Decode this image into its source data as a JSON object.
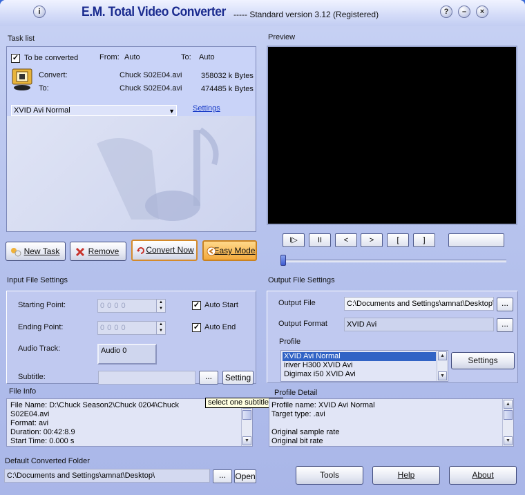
{
  "window": {
    "title": "E.M. Total Video Converter",
    "subtitle": "-----  Standard version 3.12 (Registered)",
    "info_glyph": "i",
    "help_glyph": "?",
    "min_glyph": "–",
    "close_glyph": "×"
  },
  "task_list": {
    "label": "Task list",
    "checkbox_label": "To be converted",
    "checkbox_glyph": "✓",
    "from_label": "From:",
    "from_value": "Auto",
    "to_label": "To:",
    "to_value": "Auto",
    "convert_label": "Convert:",
    "convert_file": "Chuck S02E04.avi",
    "convert_size": "358032 k Bytes",
    "to2_label": "To:",
    "to2_file": "Chuck S02E04.avi",
    "to2_size": "474485 k Bytes",
    "profile_selected": "XVID Avi Normal",
    "settings_link": "Settings",
    "dropdown_glyph": "▼"
  },
  "preview": {
    "label": "Preview"
  },
  "buttons": {
    "new_task": "New Task",
    "remove": "Remove",
    "convert_now": "Convert Now",
    "easy_mode": "Easy Mode",
    "tools": "Tools",
    "help": "Help",
    "about": "About",
    "settings": "Settings"
  },
  "player": {
    "play_glyph": "I▷",
    "pause_glyph": "II",
    "prev_glyph": "<",
    "next_glyph": ">",
    "mark_in_glyph": "[",
    "mark_out_glyph": "]",
    "seek_position": 0.0
  },
  "input_settings": {
    "label": "Input File Settings",
    "starting_point_label": "Starting Point:",
    "starting_point_value": "0    0    0    0",
    "ending_point_label": "Ending Point:",
    "ending_point_value": "0    0    0    0",
    "auto_start_label": "Auto Start",
    "auto_end_label": "Auto End",
    "audio_track_label": "Audio Track:",
    "audio_track_value": "Audio 0",
    "subtitle_label": "Subtitle:",
    "subtitle_value": "",
    "browse_glyph": "...",
    "setting_button": "Setting",
    "spin_up": "▲",
    "spin_down": "▼"
  },
  "file_info": {
    "label": "File Info",
    "lines": [
      "File Name:          D:\\Chuck Season2\\Chuck 0204\\Chuck",
      "S02E04.avi",
      "Format:               avi",
      "Duration:  00:42:8.9",
      "Start Time:          0.000  s"
    ],
    "tooltip": "select one subtitle file"
  },
  "output_settings": {
    "label": "Output File Settings",
    "output_file_label": "Output File",
    "output_file_value": "C:\\Documents and Settings\\amnat\\Desktop\\",
    "output_format_label": "Output Format",
    "output_format_value": "XVID Avi",
    "profile_label": "Profile",
    "profiles": [
      "XVID Avi Normal",
      "iriver H300 XVID Avi",
      "Digimax i50 XVID Avi"
    ],
    "profile_detail_label": "Profile Detail",
    "detail_lines": [
      "Profile name:        XVID Avi Normal",
      "Target type:          .avi",
      "",
      "Original sample rate",
      "Original bit rate"
    ]
  },
  "default_folder": {
    "label": "Default Converted Folder",
    "value": "C:\\Documents and Settings\\amnat\\Desktop\\",
    "open_button": "Open"
  },
  "colors": {
    "title": "#1a2b8f",
    "selection": "#3163c5",
    "link": "#1a3cc8",
    "preview_bg": "#000000"
  }
}
